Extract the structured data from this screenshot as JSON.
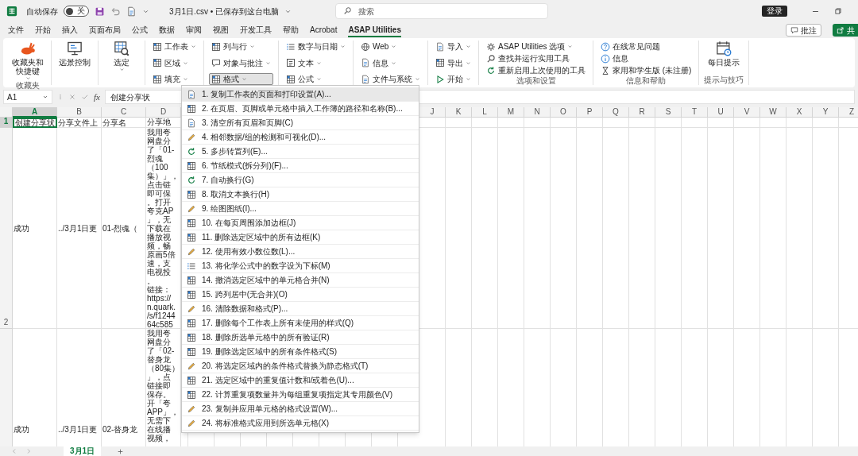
{
  "title_bar": {
    "autosave_label": "自动保存",
    "autosave": {
      "on": false,
      "label": "关"
    },
    "document_title": "3月1日.csv • 已保存到这台电脑",
    "search": {
      "placeholder": "搜索"
    },
    "sign_in": "登录"
  },
  "ribbon_tabs": [
    {
      "label": "文件",
      "selected": false
    },
    {
      "label": "开始",
      "selected": false
    },
    {
      "label": "插入",
      "selected": false
    },
    {
      "label": "页面布局",
      "selected": false
    },
    {
      "label": "公式",
      "selected": false
    },
    {
      "label": "数据",
      "selected": false
    },
    {
      "label": "审阅",
      "selected": false
    },
    {
      "label": "视图",
      "selected": false
    },
    {
      "label": "开发工具",
      "selected": false
    },
    {
      "label": "帮助",
      "selected": false
    },
    {
      "label": "Acrobat",
      "selected": false
    },
    {
      "label": "ASAP Utilities",
      "selected": true
    }
  ],
  "ribbon_actions": {
    "comments": "批注",
    "share": "共"
  },
  "ribbon": {
    "groups": [
      {
        "label": "收藏夹",
        "items": [
          {
            "kind": "large",
            "label": "收藏夹和快捷键",
            "dropdown": true,
            "expanded": false
          }
        ]
      },
      {
        "items": [
          {
            "kind": "large",
            "label": "远景控制",
            "dropdown": false,
            "expanded": false
          }
        ]
      },
      {
        "items": [
          {
            "kind": "large",
            "label": "选定",
            "dropdown": true,
            "expanded": false
          }
        ]
      },
      {
        "items": [
          {
            "kind": "small",
            "label": "工作表",
            "dropdown": true,
            "expanded": false
          },
          {
            "kind": "small",
            "label": "区域",
            "dropdown": true,
            "expanded": false
          },
          {
            "kind": "small",
            "label": "填充",
            "dropdown": true,
            "expanded": false
          }
        ]
      },
      {
        "items": [
          {
            "kind": "small",
            "label": "列与行",
            "dropdown": true,
            "expanded": false
          },
          {
            "kind": "small",
            "label": "对象与批注",
            "dropdown": true,
            "expanded": false
          },
          {
            "kind": "small",
            "label": "格式",
            "dropdown": true,
            "expanded": true
          }
        ]
      },
      {
        "items": [
          {
            "kind": "small",
            "label": "数字与日期",
            "dropdown": true,
            "expanded": false
          },
          {
            "kind": "small",
            "label": "文本",
            "dropdown": true,
            "expanded": false
          },
          {
            "kind": "small",
            "label": "公式",
            "dropdown": true,
            "expanded": false
          }
        ]
      },
      {
        "items": [
          {
            "kind": "small",
            "label": "Web",
            "dropdown": true,
            "expanded": false
          },
          {
            "kind": "small",
            "label": "信息",
            "dropdown": true,
            "expanded": false
          },
          {
            "kind": "small",
            "label": "文件与系统",
            "dropdown": true,
            "expanded": false
          }
        ]
      },
      {
        "items": [
          {
            "kind": "small",
            "label": "导入",
            "dropdown": true,
            "expanded": false
          },
          {
            "kind": "small",
            "label": "导出",
            "dropdown": true,
            "expanded": false
          },
          {
            "kind": "small",
            "label": "开始",
            "dropdown": true,
            "expanded": false
          }
        ]
      },
      {
        "label": "选项和设置",
        "items": [
          {
            "kind": "small",
            "label": "ASAP Utilities 选项",
            "dropdown": true,
            "expanded": false
          },
          {
            "kind": "small",
            "label": "查找并运行实用工具",
            "dropdown": false,
            "expanded": false
          },
          {
            "kind": "small",
            "label": "重新启用上次使用的工具",
            "dropdown": false,
            "expanded": false
          }
        ]
      },
      {
        "label": "信息和帮助",
        "items": [
          {
            "kind": "small",
            "label": "在线常见问题",
            "dropdown": false,
            "expanded": false
          },
          {
            "kind": "small",
            "label": "信息",
            "dropdown": false,
            "expanded": false
          },
          {
            "kind": "small",
            "label": "家用和学生版 (未注册)",
            "dropdown": false,
            "expanded": false
          }
        ]
      },
      {
        "label": "提示与技巧",
        "items": [
          {
            "kind": "large",
            "label": "每日提示",
            "dropdown": false,
            "expanded": false
          }
        ]
      }
    ]
  },
  "formula_bar": {
    "name_box": "A1",
    "function_label": "fx",
    "value": "创建分享状"
  },
  "sheet": {
    "columns": [
      {
        "label": "A",
        "selected": true
      },
      {
        "label": "B",
        "selected": false
      },
      {
        "label": "C",
        "selected": false
      },
      {
        "label": "D",
        "selected": false
      },
      {
        "label": "J",
        "selected": false
      },
      {
        "label": "K",
        "selected": false
      },
      {
        "label": "L",
        "selected": false
      },
      {
        "label": "M",
        "selected": false
      },
      {
        "label": "N",
        "selected": false
      },
      {
        "label": "O",
        "selected": false
      },
      {
        "label": "P",
        "selected": false
      },
      {
        "label": "Q",
        "selected": false
      },
      {
        "label": "R",
        "selected": false
      },
      {
        "label": "S",
        "selected": false
      },
      {
        "label": "T",
        "selected": false
      },
      {
        "label": "U",
        "selected": false
      },
      {
        "label": "V",
        "selected": false
      },
      {
        "label": "W",
        "selected": false
      },
      {
        "label": "X",
        "selected": false
      },
      {
        "label": "Y",
        "selected": false
      },
      {
        "label": "Z",
        "selected": false
      }
    ],
    "rows": [
      {
        "header": "1",
        "selected": true,
        "cells": [
          {
            "text": "创建分享状"
          },
          {
            "text": "分享文件上"
          },
          {
            "text": "分享名"
          },
          {
            "lines": [
              "分享地"
            ]
          }
        ]
      },
      {
        "header": "2",
        "selected": false,
        "cells": [
          {
            "text": "成功"
          },
          {
            "text": "../3月1日更"
          },
          {
            "text": "01-烈魂（"
          },
          {
            "lines": [
              "我用夸",
              "网盘分",
              "了「01-",
              "烈魂",
              "（100",
              "集）」，",
              "点击链",
              "即可保",
              "。打开",
              "夸克AP",
              "」，无",
              "下载在",
              "播放视",
              "频，畅",
              "原画5倍",
              "速，支",
              "电视投",
              "。",
              "链接：",
              "https://",
              "n.quark.",
              "/s/f1244",
              "64c585"
            ]
          }
        ]
      },
      {
        "selected": false,
        "cells": [
          {
            "text": "成功"
          },
          {
            "text": "../3月1日更"
          },
          {
            "text": "02-替身龙"
          },
          {
            "lines": [
              "我用夸",
              "网盘分",
              "了「02-",
              "替身龙",
              "（80集）",
              "」，点",
              "链接即",
              "保存。",
              "开「夸",
              "APP」，",
              "无需下",
              "在线播",
              "视频，"
            ]
          }
        ]
      }
    ],
    "tabs": [
      {
        "label": "3月1日",
        "selected": true
      }
    ]
  },
  "format_menu": {
    "items": [
      {
        "label": "1. 复制工作表的页面和打印设置(A)...",
        "selected": true
      },
      {
        "label": "2. 在页眉、页脚或单元格中插入工作簿的路径和名称(B)...",
        "selected": false
      },
      {
        "label": "3. 清空所有页眉和页脚(C)",
        "selected": false
      },
      {
        "label": "4. 相邻数据/组的检测和可视化(D)...",
        "selected": false
      },
      {
        "label": "5. 多步转置列(E)...",
        "selected": false
      },
      {
        "label": "6. 节纸模式(拆分列)(F)...",
        "selected": false
      },
      {
        "label": "7. 自动换行(G)",
        "selected": false
      },
      {
        "label": "8. 取消文本换行(H)",
        "selected": false
      },
      {
        "label": "9. 绘图图纸(I)...",
        "selected": false
      },
      {
        "label": "10. 在每页周围添加边框(J)",
        "selected": false
      },
      {
        "label": "11. 删除选定区域中的所有边框(K)",
        "selected": false
      },
      {
        "label": "12. 使用有效小数位数(L)...",
        "selected": false
      },
      {
        "label": "13. 将化学公式中的数字设为下标(M)",
        "selected": false
      },
      {
        "label": "14. 撤消选定区域中的单元格合并(N)",
        "selected": false
      },
      {
        "label": "15. 跨列居中(无合并)(O)",
        "selected": false
      },
      {
        "label": "16. 清除数据和格式(P)...",
        "selected": false
      },
      {
        "label": "17. 删除每个工作表上所有未使用的样式(Q)",
        "selected": false
      },
      {
        "label": "18. 删除所选单元格中的所有验证(R)",
        "selected": false
      },
      {
        "label": "19. 删除选定区域中的所有条件格式(S)",
        "selected": false
      },
      {
        "label": "20. 将选定区域内的条件格式替换为静态格式(T)",
        "selected": false
      },
      {
        "label": "21. 选定区域中的重复值计数和/或着色(U)...",
        "selected": false
      },
      {
        "label": "22. 计算重复项数量并为每组重复项指定其专用颜色(V)",
        "selected": false
      },
      {
        "label": "23. 复制并应用单元格的格式设置(W)...",
        "selected": false
      },
      {
        "label": "24. 将标准格式应用到所选单元格(X)",
        "selected": false
      }
    ]
  }
}
